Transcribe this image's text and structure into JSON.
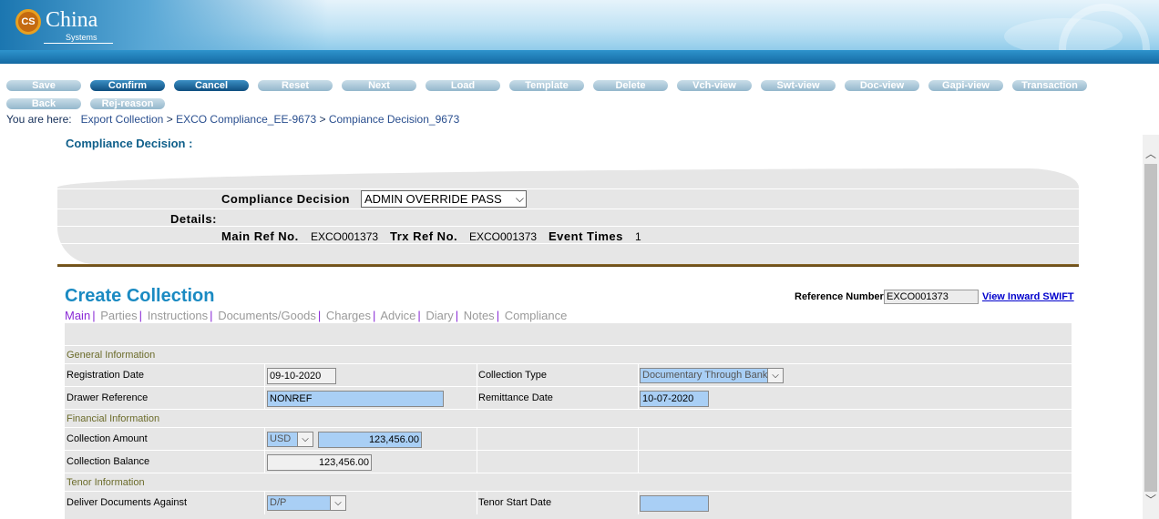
{
  "brand": {
    "mark": "CS",
    "name": "China",
    "sub": "Systems"
  },
  "toolbar": {
    "buttons": [
      "Save",
      "Confirm",
      "Cancel",
      "Reset",
      "Next",
      "Load",
      "Template",
      "Delete",
      "Vch-view",
      "Swt-view",
      "Doc-view",
      "Gapi-view",
      "Transaction",
      "Back",
      "Rej-reason"
    ],
    "active": [
      "Confirm",
      "Cancel"
    ]
  },
  "breadcrumb": {
    "label": "You are here:",
    "items": [
      "Export Collection",
      "EXCO Compliance_EE-9673",
      "Compiance Decision_9673"
    ],
    "sep": ">"
  },
  "compliance": {
    "title": "Compliance Decision :",
    "decision_label": "Compliance Decision",
    "decision_value": "ADMIN OVERRIDE PASS",
    "details_label": "Details:",
    "main_ref_label": "Main Ref No.",
    "main_ref_value": "EXCO001373",
    "trx_ref_label": "Trx Ref No.",
    "trx_ref_value": "EXCO001373",
    "event_label": "Event Times",
    "event_value": "1"
  },
  "create": {
    "title": "Create Collection",
    "ref_label": "Reference Number",
    "ref_value": "EXCO001373",
    "swift_link": "View Inward SWIFT",
    "tabs": [
      "Main",
      "Parties",
      "Instructions",
      "Documents/Goods",
      "Charges",
      "Advice",
      "Diary",
      "Notes",
      "Compliance"
    ]
  },
  "form": {
    "general_section": "General Information",
    "registration_date_label": "Registration Date",
    "registration_date": "09-10-2020",
    "collection_type_label": "Collection Type",
    "collection_type": "Documentary Through Bank",
    "drawer_ref_label": "Drawer Reference",
    "drawer_ref": "NONREF",
    "remittance_date_label": "Remittance Date",
    "remittance_date": "10-07-2020",
    "financial_section": "Financial Information",
    "collection_amount_label": "Collection Amount",
    "currency": "USD",
    "collection_amount": "123,456.00",
    "collection_balance_label": "Collection Balance",
    "collection_balance": "123,456.00",
    "tenor_section": "Tenor Information",
    "deliver_docs_label": "Deliver Documents Against",
    "deliver_docs": "D/P",
    "tenor_start_label": "Tenor Start Date",
    "tenor_start": ""
  }
}
